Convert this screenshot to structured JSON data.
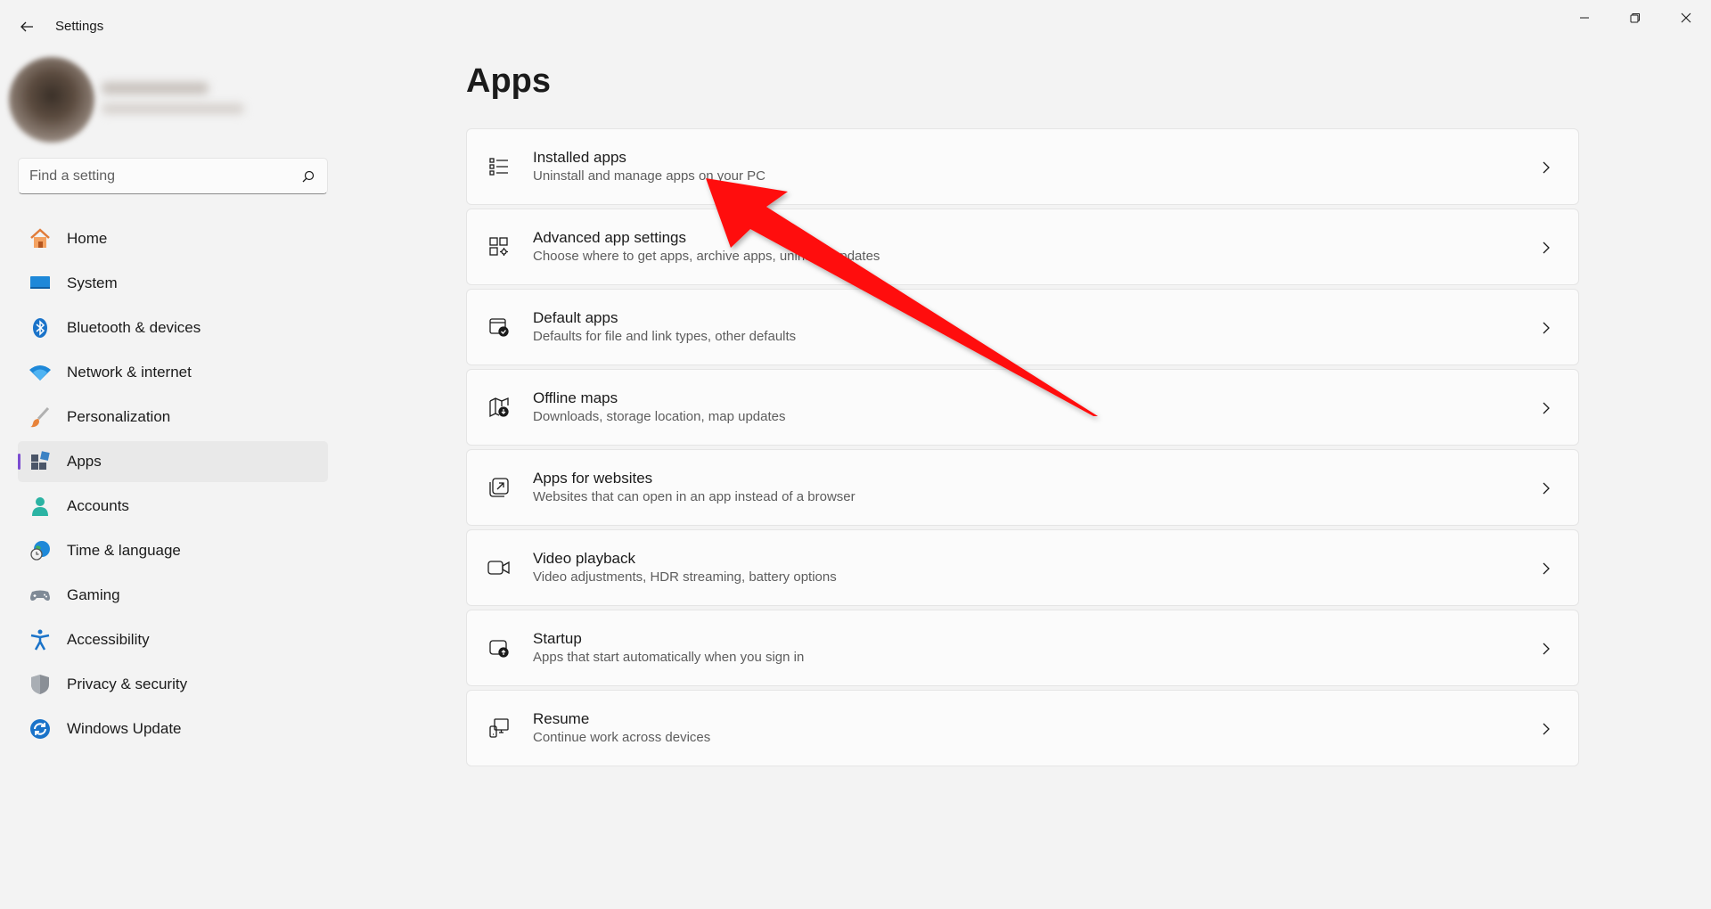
{
  "window": {
    "title": "Settings",
    "controls": [
      "minimize-icon",
      "restore-icon",
      "close-icon"
    ]
  },
  "search": {
    "placeholder": "Find a setting",
    "icon": "search-icon"
  },
  "sidebar": {
    "items": [
      {
        "label": "Home",
        "icon": "home-icon"
      },
      {
        "label": "System",
        "icon": "monitor-icon"
      },
      {
        "label": "Bluetooth & devices",
        "icon": "bluetooth-icon"
      },
      {
        "label": "Network & internet",
        "icon": "wifi-icon"
      },
      {
        "label": "Personalization",
        "icon": "brush-icon"
      },
      {
        "label": "Apps",
        "icon": "apps-icon",
        "active": true
      },
      {
        "label": "Accounts",
        "icon": "person-icon"
      },
      {
        "label": "Time & language",
        "icon": "globe-clock-icon"
      },
      {
        "label": "Gaming",
        "icon": "gamepad-icon"
      },
      {
        "label": "Accessibility",
        "icon": "accessibility-icon"
      },
      {
        "label": "Privacy & security",
        "icon": "shield-icon"
      },
      {
        "label": "Windows Update",
        "icon": "update-icon"
      }
    ]
  },
  "main": {
    "title": "Apps",
    "cards": [
      {
        "title": "Installed apps",
        "subtitle": "Uninstall and manage apps on your PC",
        "icon": "list-icon"
      },
      {
        "title": "Advanced app settings",
        "subtitle": "Choose where to get apps, archive apps, uninstall updates",
        "icon": "app-settings-icon"
      },
      {
        "title": "Default apps",
        "subtitle": "Defaults for file and link types, other defaults",
        "icon": "default-apps-icon"
      },
      {
        "title": "Offline maps",
        "subtitle": "Downloads, storage location, map updates",
        "icon": "map-icon"
      },
      {
        "title": "Apps for websites",
        "subtitle": "Websites that can open in an app instead of a browser",
        "icon": "open-in-app-icon"
      },
      {
        "title": "Video playback",
        "subtitle": "Video adjustments, HDR streaming, battery options",
        "icon": "video-icon"
      },
      {
        "title": "Startup",
        "subtitle": "Apps that start automatically when you sign in",
        "icon": "startup-icon"
      },
      {
        "title": "Resume",
        "subtitle": "Continue work across devices",
        "icon": "resume-icon"
      }
    ]
  },
  "colors": {
    "accent": "#7c4dd1",
    "annotation_arrow": "#ff0000",
    "background": "#f3f3f3"
  }
}
